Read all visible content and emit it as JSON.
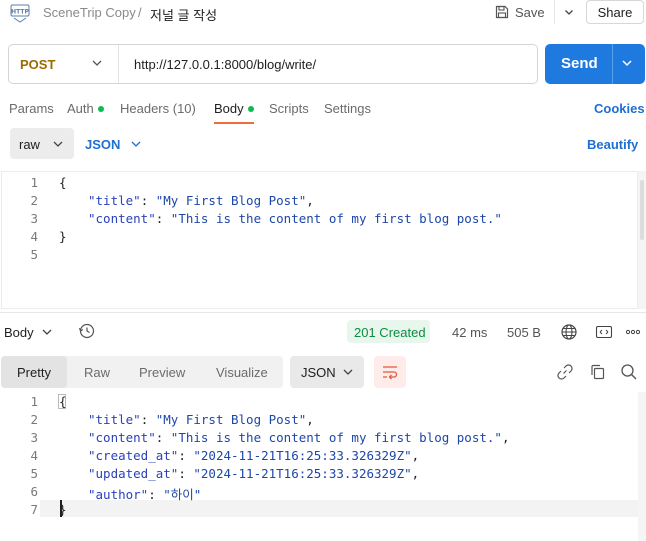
{
  "header": {
    "app_icon_label": "HTTP",
    "breadcrumb_parent": "SceneTrip Copy",
    "breadcrumb_sep": "/",
    "title": "저널 글 작성",
    "save_label": "Save",
    "share_label": "Share"
  },
  "request": {
    "method": "POST",
    "url": "http://127.0.0.1:8000/blog/write/",
    "send_label": "Send"
  },
  "request_tabs": [
    {
      "label": "Params",
      "dot": false
    },
    {
      "label": "Auth",
      "dot": true
    },
    {
      "label": "Headers (10)",
      "dot": false
    },
    {
      "label": "Body",
      "dot": true,
      "active": true
    },
    {
      "label": "Scripts",
      "dot": false
    },
    {
      "label": "Settings",
      "dot": false
    }
  ],
  "cookies_label": "Cookies",
  "body_options": {
    "mode": "raw",
    "format": "JSON",
    "beautify_label": "Beautify"
  },
  "request_body_lines": [
    {
      "n": "1",
      "text": "{"
    },
    {
      "n": "2",
      "key": "\"title\"",
      "value": "\"My First Blog Post\"",
      "end": ","
    },
    {
      "n": "3",
      "key": "\"content\"",
      "value": "\"This is the content of my first blog post.\"",
      "end": ""
    },
    {
      "n": "4",
      "text": "}"
    },
    {
      "n": "5",
      "text": ""
    }
  ],
  "response": {
    "body_label": "Body",
    "status": "201 Created",
    "time": "42 ms",
    "size": "505 B",
    "tabs": [
      "Pretty",
      "Raw",
      "Preview",
      "Visualize"
    ],
    "active_tab": "Pretty",
    "format": "JSON"
  },
  "response_body_lines": [
    {
      "n": "1",
      "text": "{"
    },
    {
      "n": "2",
      "key": "\"title\"",
      "value": "\"My First Blog Post\"",
      "end": ","
    },
    {
      "n": "3",
      "key": "\"content\"",
      "value": "\"This is the content of my first blog post.\"",
      "end": ","
    },
    {
      "n": "4",
      "key": "\"created_at\"",
      "value": "\"2024-11-21T16:25:33.326329Z\"",
      "end": ","
    },
    {
      "n": "5",
      "key": "\"updated_at\"",
      "value": "\"2024-11-21T16:25:33.326329Z\"",
      "end": ","
    },
    {
      "n": "6",
      "key": "\"author\"",
      "value": "\"하이\"",
      "end": ""
    },
    {
      "n": "7",
      "text": "}"
    }
  ],
  "colors": {
    "accent": "#1f7ae0",
    "method": "#9e6a00",
    "status_ok": "#0c8e3e",
    "tab_underline": "#f26b3a",
    "dot": "#0cbb52"
  }
}
